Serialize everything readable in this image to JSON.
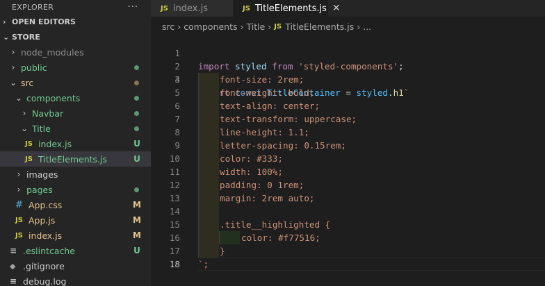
{
  "explorer": {
    "title": "EXPLORER",
    "more_icon": "ellipsis-icon",
    "open_editors": "OPEN EDITORS",
    "root": "STORE",
    "items": [
      {
        "label": "node_modules",
        "badge": ""
      },
      {
        "label": "public",
        "badge": ""
      },
      {
        "label": "src",
        "badge": ""
      },
      {
        "label": "components",
        "badge": ""
      },
      {
        "label": "Navbar",
        "badge": ""
      },
      {
        "label": "Title",
        "badge": ""
      },
      {
        "label": "index.js",
        "badge": "U"
      },
      {
        "label": "TitleElements.js",
        "badge": "U"
      },
      {
        "label": "images",
        "badge": ""
      },
      {
        "label": "pages",
        "badge": ""
      },
      {
        "label": "App.css",
        "badge": "M"
      },
      {
        "label": "App.js",
        "badge": "M"
      },
      {
        "label": "index.js",
        "badge": "M"
      },
      {
        "label": ".eslintcache",
        "badge": "U"
      },
      {
        "label": ".gitignore",
        "badge": ""
      },
      {
        "label": "debug.log",
        "badge": ""
      }
    ],
    "js_icon_text": "JS",
    "css_icon_text": "#"
  },
  "tabs": [
    {
      "label": "index.js",
      "icon": "JS"
    },
    {
      "label": "TitleElements.js",
      "icon": "JS",
      "close": "✕"
    }
  ],
  "breadcrumb": {
    "parts": [
      "src",
      "components",
      "Title",
      "TitleElements.js",
      "..."
    ],
    "sep": "›"
  },
  "code": {
    "line_numbers": [
      "1",
      "2",
      "3",
      "4",
      "5",
      "6",
      "7",
      "8",
      "9",
      "10",
      "11",
      "12",
      "13",
      "14",
      "15",
      "16",
      "17",
      "18"
    ],
    "l1": {
      "kw": "import",
      "name": " styled ",
      "from": "from",
      "str": " 'styled-components'",
      "end": ";"
    },
    "l3": {
      "kw": "export",
      "const": " const ",
      "name": "TitleContainer",
      "eq": " = ",
      "obj": "styled",
      "dot": ".",
      "fn": "h1",
      "tick": "`"
    },
    "css": [
      "font-size: 2rem;",
      "font-weight: bold;",
      "text-align: center;",
      "text-transform: uppercase;",
      "line-height: 1.1;",
      "letter-spacing: 0.15rem;",
      "color: #333;",
      "width: 100%;",
      "padding: 0 1rem;",
      "margin: 2rem auto;"
    ],
    "l15": ".title__highlighted {",
    "l16": "color: #f77516;",
    "l17": "}",
    "l18": "`;"
  }
}
